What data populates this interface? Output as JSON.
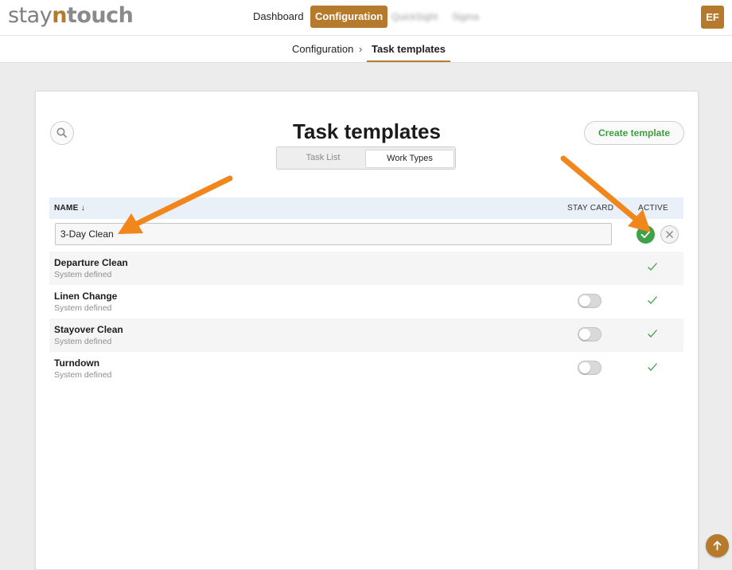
{
  "brand": {
    "logo_pre": "stay",
    "logo_accent": "n",
    "logo_post": "touch"
  },
  "nav": {
    "items": [
      {
        "label": "Dashboard",
        "active": false
      },
      {
        "label": "Configuration",
        "active": true
      },
      {
        "label": "QuickSight",
        "active": false,
        "blurred": true
      },
      {
        "label": "Sigma",
        "active": false,
        "blurred": true
      }
    ],
    "avatar_initials": "EF"
  },
  "breadcrumb": {
    "parent": "Configuration",
    "separator": "›",
    "current": "Task templates"
  },
  "page": {
    "title": "Task templates",
    "create_label": "Create template",
    "segments": [
      {
        "label": "Task List",
        "active": false
      },
      {
        "label": "Work Types",
        "active": true
      }
    ]
  },
  "table": {
    "headers": {
      "name": "NAME ↓",
      "stay_card": "STAY CARD",
      "active": "ACTIVE"
    },
    "edit_row": {
      "value": "3-Day Clean"
    },
    "rows": [
      {
        "name": "Departure Clean",
        "subtitle": "System defined",
        "stay_card_toggle": false,
        "stay_card_visible": false,
        "active": true
      },
      {
        "name": "Linen Change",
        "subtitle": "System defined",
        "stay_card_toggle": false,
        "stay_card_visible": true,
        "active": true
      },
      {
        "name": "Stayover Clean",
        "subtitle": "System defined",
        "stay_card_toggle": false,
        "stay_card_visible": true,
        "active": true
      },
      {
        "name": "Turndown",
        "subtitle": "System defined",
        "stay_card_toggle": false,
        "stay_card_visible": true,
        "active": true
      }
    ]
  },
  "colors": {
    "brand": "#b57a2c",
    "success": "#3fa24a",
    "annotation_arrow": "#f0861c",
    "header_bg": "#e9f0f7"
  }
}
